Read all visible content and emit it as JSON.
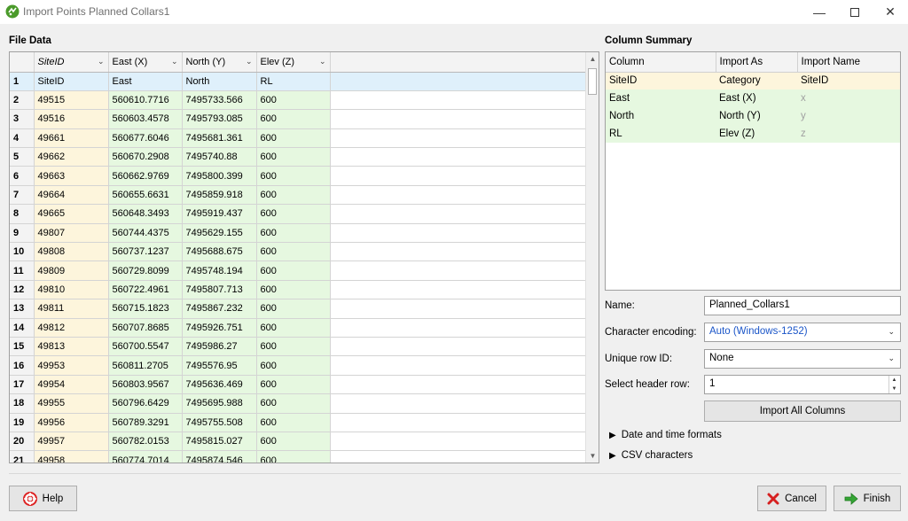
{
  "window": {
    "title": "Import Points Planned Collars1"
  },
  "file_data": {
    "label": "File Data",
    "columns": [
      {
        "name": "SiteID"
      },
      {
        "name": "East (X)"
      },
      {
        "name": "North (Y)"
      },
      {
        "name": "Elev (Z)"
      }
    ],
    "rows": [
      [
        "1",
        "SiteID",
        "East",
        "North",
        "RL"
      ],
      [
        "2",
        "49515",
        "560610.7716",
        "7495733.566",
        "600"
      ],
      [
        "3",
        "49516",
        "560603.4578",
        "7495793.085",
        "600"
      ],
      [
        "4",
        "49661",
        "560677.6046",
        "7495681.361",
        "600"
      ],
      [
        "5",
        "49662",
        "560670.2908",
        "7495740.88",
        "600"
      ],
      [
        "6",
        "49663",
        "560662.9769",
        "7495800.399",
        "600"
      ],
      [
        "7",
        "49664",
        "560655.6631",
        "7495859.918",
        "600"
      ],
      [
        "8",
        "49665",
        "560648.3493",
        "7495919.437",
        "600"
      ],
      [
        "9",
        "49807",
        "560744.4375",
        "7495629.155",
        "600"
      ],
      [
        "10",
        "49808",
        "560737.1237",
        "7495688.675",
        "600"
      ],
      [
        "11",
        "49809",
        "560729.8099",
        "7495748.194",
        "600"
      ],
      [
        "12",
        "49810",
        "560722.4961",
        "7495807.713",
        "600"
      ],
      [
        "13",
        "49811",
        "560715.1823",
        "7495867.232",
        "600"
      ],
      [
        "14",
        "49812",
        "560707.8685",
        "7495926.751",
        "600"
      ],
      [
        "15",
        "49813",
        "560700.5547",
        "7495986.27",
        "600"
      ],
      [
        "16",
        "49953",
        "560811.2705",
        "7495576.95",
        "600"
      ],
      [
        "17",
        "49954",
        "560803.9567",
        "7495636.469",
        "600"
      ],
      [
        "18",
        "49955",
        "560796.6429",
        "7495695.988",
        "600"
      ],
      [
        "19",
        "49956",
        "560789.3291",
        "7495755.508",
        "600"
      ],
      [
        "20",
        "49957",
        "560782.0153",
        "7495815.027",
        "600"
      ],
      [
        "21",
        "49958",
        "560774.7014",
        "7495874.546",
        "600"
      ]
    ]
  },
  "column_summary": {
    "label": "Column Summary",
    "headers": [
      "Column",
      "Import As",
      "Import Name"
    ],
    "rows": [
      {
        "column": "SiteID",
        "import_as": "Category",
        "import_name": "SiteID"
      },
      {
        "column": "East",
        "import_as": "East (X)",
        "import_name": "x"
      },
      {
        "column": "North",
        "import_as": "North (Y)",
        "import_name": "y"
      },
      {
        "column": "RL",
        "import_as": "Elev (Z)",
        "import_name": "z"
      }
    ]
  },
  "form": {
    "name_label": "Name:",
    "name_value": "Planned_Collars1",
    "encoding_label": "Character encoding:",
    "encoding_value": "Auto (Windows-1252)",
    "unique_row_label": "Unique row ID:",
    "unique_row_value": "None",
    "header_row_label": "Select header row:",
    "header_row_value": "1",
    "import_all_label": "Import All Columns",
    "date_formats_label": "Date and time formats",
    "csv_characters_label": "CSV characters"
  },
  "footer": {
    "help_label": "Help",
    "cancel_label": "Cancel",
    "finish_label": "Finish"
  }
}
